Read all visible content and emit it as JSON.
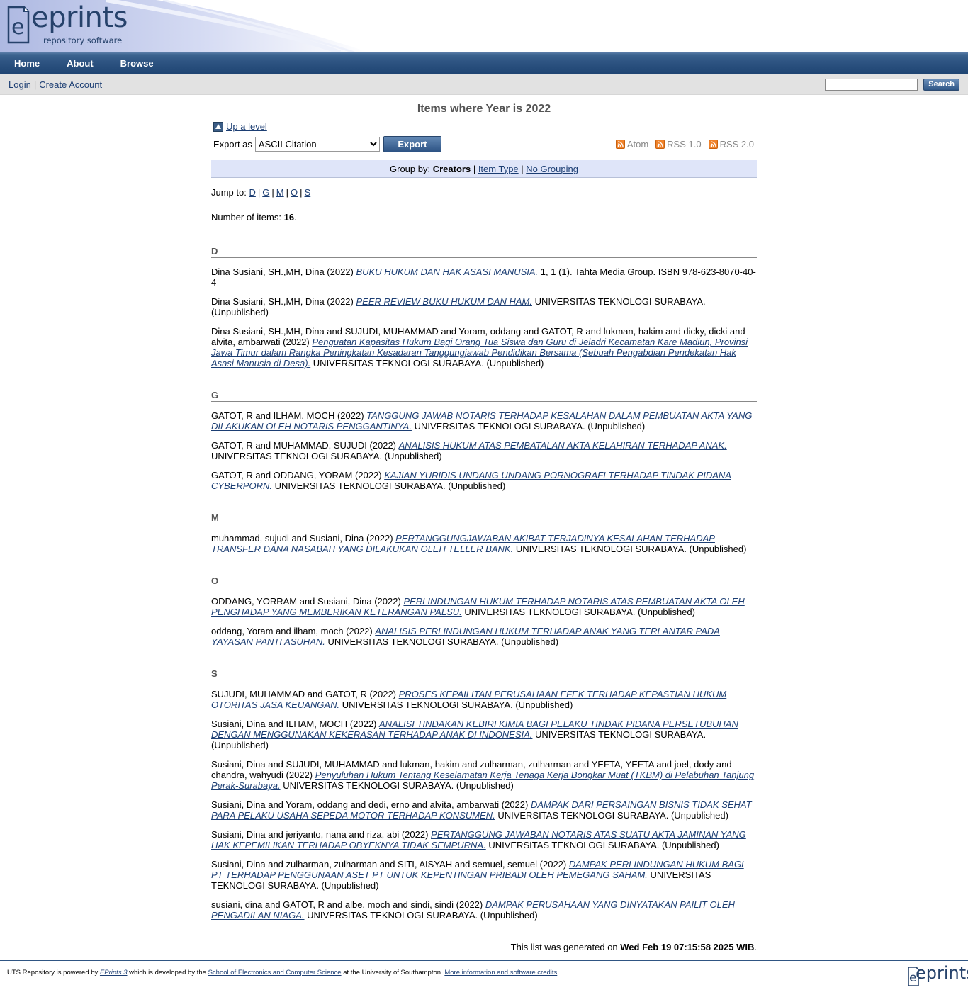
{
  "header": {
    "logo_word": "eprints",
    "logo_tagline": "repository software"
  },
  "nav": {
    "home": "Home",
    "about": "About",
    "browse": "Browse"
  },
  "account": {
    "login": "Login",
    "create_account": "Create Account"
  },
  "search": {
    "button": "Search",
    "value": ""
  },
  "page": {
    "title": "Items where Year is 2022",
    "up_level": "Up a level",
    "export_label": "Export as",
    "export_selected": "ASCII Citation",
    "export_button": "Export",
    "feeds": {
      "atom": "Atom",
      "rss1": "RSS 1.0",
      "rss2": "RSS 2.0"
    },
    "group_by_label": "Group by:",
    "group_current": "Creators",
    "group_item_type": "Item Type",
    "group_no_grouping": "No Grouping",
    "jump_to_label": "Jump to:",
    "jump_letters": [
      "D",
      "G",
      "M",
      "O",
      "S"
    ],
    "number_items_label": "Number of items:",
    "number_items": "16",
    "generated_prefix": "This list was generated on",
    "generated_date": "Wed Feb 19 07:15:58 2025 WIB"
  },
  "sections": [
    {
      "letter": "D",
      "items": [
        {
          "authors": "Dina Susiani, SH.,MH, Dina (2022)",
          "title": "BUKU HUKUM DAN HAK ASASI MANUSIA.",
          "rest": "1, 1 (1). Tahta Media Group. ISBN 978-623-8070-40-4"
        },
        {
          "authors": "Dina Susiani, SH.,MH, Dina (2022)",
          "title": "PEER REVIEW BUKU HUKUM DAN HAM.",
          "rest": "UNIVERSITAS TEKNOLOGI SURABAYA. (Unpublished)"
        },
        {
          "authors": "Dina Susiani, SH.,MH, Dina and SUJUDI, MUHAMMAD and Yoram, oddang and GATOT, R and lukman, hakim and dicky, dicki and alvita, ambarwati (2022)",
          "title": "Penguatan Kapasitas Hukum Bagi Orang Tua Siswa dan Guru di Jeladri Kecamatan Kare Madiun, Provinsi Jawa Timur dalam Rangka Peningkatan Kesadaran Tanggungjawab Pendidikan Bersama (Sebuah Pengabdian Pendekatan Hak Asasi Manusia di Desa).",
          "rest": "UNIVERSITAS TEKNOLOGI SURABAYA. (Unpublished)"
        }
      ]
    },
    {
      "letter": "G",
      "items": [
        {
          "authors": "GATOT, R and ILHAM, MOCH (2022)",
          "title": "TANGGUNG JAWAB NOTARIS TERHADAP KESALAHAN DALAM PEMBUATAN AKTA YANG DILAKUKAN OLEH NOTARIS PENGGANTINYA.",
          "rest": "UNIVERSITAS TEKNOLOGI SURABAYA. (Unpublished)"
        },
        {
          "authors": "GATOT, R and MUHAMMAD, SUJUDI (2022)",
          "title": "ANALISIS HUKUM ATAS PEMBATALAN AKTA KELAHIRAN TERHADAP ANAK.",
          "rest": "UNIVERSITAS TEKNOLOGI SURABAYA. (Unpublished)"
        },
        {
          "authors": "GATOT, R and ODDANG, YORAM (2022)",
          "title": "KAJIAN YURIDIS UNDANG UNDANG PORNOGRAFI TERHADAP TINDAK PIDANA CYBERPORN.",
          "rest": "UNIVERSITAS TEKNOLOGI SURABAYA. (Unpublished)"
        }
      ]
    },
    {
      "letter": "M",
      "items": [
        {
          "authors": "muhammad, sujudi and Susiani, Dina (2022)",
          "title": "PERTANGGUNGJAWABAN AKIBAT TERJADINYA KESALAHAN TERHADAP TRANSFER DANA NASABAH YANG DILAKUKAN OLEH TELLER BANK.",
          "rest": "UNIVERSITAS TEKNOLOGI SURABAYA. (Unpublished)"
        }
      ]
    },
    {
      "letter": "O",
      "items": [
        {
          "authors": "ODDANG, YORRAM and Susiani, Dina (2022)",
          "title": "PERLINDUNGAN HUKUM TERHADAP NOTARIS ATAS PEMBUATAN AKTA OLEH PENGHADAP YANG MEMBERIKAN KETERANGAN PALSU.",
          "rest": "UNIVERSITAS TEKNOLOGI SURABAYA. (Unpublished)"
        },
        {
          "authors": "oddang, Yoram and ilham, moch (2022)",
          "title": "ANALISIS PERLINDUNGAN HUKUM TERHADAP ANAK YANG TERLANTAR PADA YAYASAN PANTI ASUHAN.",
          "rest": "UNIVERSITAS TEKNOLOGI SURABAYA. (Unpublished)"
        }
      ]
    },
    {
      "letter": "S",
      "items": [
        {
          "authors": "SUJUDI, MUHAMMAD and GATOT, R (2022)",
          "title": "PROSES KEPAILITAN PERUSAHAAN EFEK TERHADAP KEPASTIAN HUKUM OTORITAS JASA KEUANGAN.",
          "rest": "UNIVERSITAS TEKNOLOGI SURABAYA. (Unpublished)"
        },
        {
          "authors": "Susiani, Dina and ILHAM, MOCH (2022)",
          "title": "ANALISI TINDAKAN KEBIRI KIMIA BAGI PELAKU TINDAK PIDANA PERSETUBUHAN DENGAN MENGGUNAKAN KEKERASAN TERHADAP ANAK DI INDONESIA.",
          "rest": "UNIVERSITAS TEKNOLOGI SURABAYA. (Unpublished)"
        },
        {
          "authors": "Susiani, Dina and SUJUDI, MUHAMMAD and lukman, hakim and zulharman, zulharman and YEFTA, YEFTA and joel, dody and chandra, wahyudi (2022)",
          "title": "Penyuluhan Hukum Tentang Keselamatan Kerja Tenaga Kerja Bongkar Muat (TKBM) di Pelabuhan Tanjung Perak-Surabaya.",
          "rest": "UNIVERSITAS TEKNOLOGI SURABAYA. (Unpublished)"
        },
        {
          "authors": "Susiani, Dina and Yoram, oddang and dedi, erno and alvita, ambarwati (2022)",
          "title": "DAMPAK DARI PERSAINGAN BISNIS TIDAK SEHAT PARA PELAKU USAHA SEPEDA MOTOR TERHADAP KONSUMEN.",
          "rest": "UNIVERSITAS TEKNOLOGI SURABAYA. (Unpublished)"
        },
        {
          "authors": "Susiani, Dina and jeriyanto, nana and riza, abi (2022)",
          "title": "PERTANGGUNG JAWABAN NOTARIS ATAS SUATU AKTA JAMINAN YANG HAK KEPEMILIKAN TERHADAP OBYEKNYA TIDAK SEMPURNA.",
          "rest": "UNIVERSITAS TEKNOLOGI SURABAYA. (Unpublished)"
        },
        {
          "authors": "Susiani, Dina and zulharman, zulharman and SITI, AISYAH and semuel, semuel (2022)",
          "title": "DAMPAK PERLINDUNGAN HUKUM BAGI PT TERHADAP PENGGUNAAN ASET PT UNTUK KEPENTINGAN PRIBADI OLEH PEMEGANG SAHAM.",
          "rest": "UNIVERSITAS TEKNOLOGI SURABAYA. (Unpublished)"
        },
        {
          "authors": "susiani, dina and GATOT, R and albe, moch and sindi, sindi (2022)",
          "title": "DAMPAK PERUSAHAAN YANG DINYATAKAN PAILIT OLEH PENGADILAN NIAGA.",
          "rest": "UNIVERSITAS TEKNOLOGI SURABAYA. (Unpublished)"
        }
      ]
    }
  ],
  "footer": {
    "t1": "UTS Repository is powered by",
    "link1": "EPrints 3",
    "t2": "which is developed by the",
    "link2": "School of Electronics and Computer Science",
    "t3": "at the University of Southampton.",
    "link3": "More information and software credits",
    "t4": ".",
    "logo_word": "eprints"
  }
}
